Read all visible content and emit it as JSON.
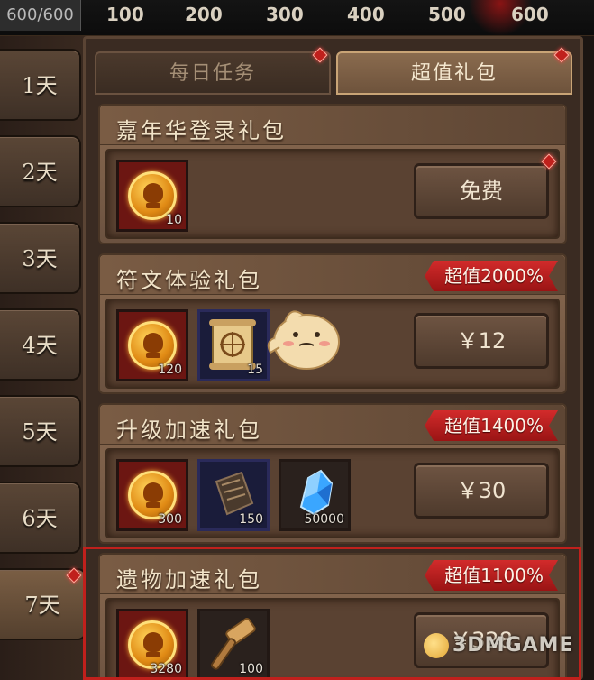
{
  "topbar": {
    "hp_text": "600/600",
    "ticks": [
      "100",
      "200",
      "300",
      "400",
      "500",
      "600"
    ]
  },
  "days": [
    {
      "label": "1天",
      "active": false
    },
    {
      "label": "2天",
      "active": false
    },
    {
      "label": "3天",
      "active": false
    },
    {
      "label": "4天",
      "active": false
    },
    {
      "label": "5天",
      "active": false
    },
    {
      "label": "6天",
      "active": false
    },
    {
      "label": "7天",
      "active": true
    }
  ],
  "tabs": [
    {
      "label": "每日任务",
      "active": false
    },
    {
      "label": "超值礼包",
      "active": true
    }
  ],
  "packs": [
    {
      "title": "嘉年华登录礼包",
      "badge": "",
      "button": "免费",
      "items": [
        {
          "icon": "gold-coin-icon",
          "qty": "10"
        }
      ]
    },
    {
      "title": "符文体验礼包",
      "badge": "超值2000%",
      "button": "￥12",
      "items": [
        {
          "icon": "gold-coin-icon",
          "qty": "120"
        },
        {
          "icon": "rune-scroll-icon",
          "qty": "15"
        }
      ]
    },
    {
      "title": "升级加速礼包",
      "badge": "超值1400%",
      "button": "￥30",
      "items": [
        {
          "icon": "gold-coin-icon",
          "qty": "300"
        },
        {
          "icon": "speedup-scroll-icon",
          "qty": "150"
        },
        {
          "icon": "blue-crystal-icon",
          "qty": "50000"
        }
      ]
    },
    {
      "title": "遗物加速礼包",
      "badge": "超值1100%",
      "button": "￥328",
      "items": [
        {
          "icon": "gold-coin-icon",
          "qty": "3280"
        },
        {
          "icon": "hammer-icon",
          "qty": "100"
        }
      ]
    }
  ],
  "watermark": "3DMGAME",
  "colors": {
    "badge_red": "#c0201c",
    "panel_brown": "#6b5240",
    "coin_gold": "#ffd45a"
  }
}
